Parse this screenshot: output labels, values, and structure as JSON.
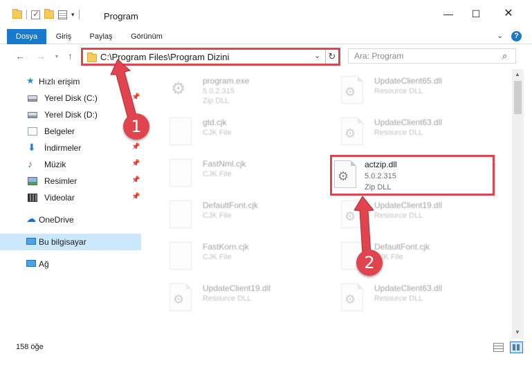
{
  "window": {
    "title": "Program",
    "minimize_glyph": "—",
    "maximize_glyph": "☐",
    "close_glyph": "✕"
  },
  "ribbon": {
    "tabs": [
      {
        "label": "Dosya",
        "active": true
      },
      {
        "label": "Giriş"
      },
      {
        "label": "Paylaş"
      },
      {
        "label": "Görünüm"
      }
    ],
    "help": "?"
  },
  "address": {
    "path": "C:\\Program Files\\Program Dizini",
    "search_placeholder": "Ara: Program"
  },
  "sidebar": {
    "items": [
      {
        "label": "Hızlı erişim",
        "icon": "star-icon"
      },
      {
        "label": "Yerel Disk (C:)",
        "icon": "disk-icon",
        "pinned": true
      },
      {
        "label": "Yerel Disk (D:)",
        "icon": "disk-icon"
      },
      {
        "label": "Belgeler",
        "icon": "documents-icon",
        "pinned": true
      },
      {
        "label": "İndirmeler",
        "icon": "downloads-icon",
        "pinned": true
      },
      {
        "label": "Müzik",
        "icon": "music-icon",
        "pinned": true
      },
      {
        "label": "Resimler",
        "icon": "pictures-icon",
        "pinned": true
      },
      {
        "label": "Videolar",
        "icon": "videos-icon",
        "pinned": true
      },
      {
        "label": "OneDrive",
        "icon": "cloud-icon"
      },
      {
        "label": "Bu bilgisayar",
        "icon": "computer-icon",
        "selected": true
      },
      {
        "label": "Ağ",
        "icon": "network-icon"
      }
    ]
  },
  "files": [
    {
      "name": "program.exe",
      "meta1": "5.0.2.315",
      "meta2": "Zip DLL",
      "kind": "exe"
    },
    {
      "name": "UpdateClient65.dll",
      "meta1": "Resource DLL",
      "meta2": "",
      "kind": "dll"
    },
    {
      "name": "gtd.cjk",
      "meta1": "CJK File",
      "meta2": "",
      "kind": "doc"
    },
    {
      "name": "UpdateClient63.dll",
      "meta1": "Resource DLL",
      "meta2": "",
      "kind": "dll"
    },
    {
      "name": "FastNml.cjk",
      "meta1": "CJK File",
      "meta2": "",
      "kind": "doc"
    },
    {
      "name": "actzip.dll",
      "meta1": "5.0.2.315",
      "meta2": "Zip DLL",
      "kind": "dll",
      "highlighted": true
    },
    {
      "name": "DefaultFont.cjk",
      "meta1": "CJK File",
      "meta2": "",
      "kind": "doc"
    },
    {
      "name": "UpdateClient19.dll",
      "meta1": "Resource DLL",
      "meta2": "",
      "kind": "dll"
    },
    {
      "name": "FastKorn.cjk",
      "meta1": "CJK File",
      "meta2": "",
      "kind": "doc"
    },
    {
      "name": "DefaultFont.cjk",
      "meta1": "CJK File",
      "meta2": "",
      "kind": "doc"
    },
    {
      "name": "UpdateClient19.dll",
      "meta1": "Resource DLL",
      "meta2": "",
      "kind": "dll"
    },
    {
      "name": "UpdateClient63.dll",
      "meta1": "Resource DLL",
      "meta2": "",
      "kind": "dll"
    }
  ],
  "status": {
    "count": "158 öğe"
  },
  "annotations": {
    "step1": "1",
    "step2": "2",
    "color": "#e0444e"
  }
}
